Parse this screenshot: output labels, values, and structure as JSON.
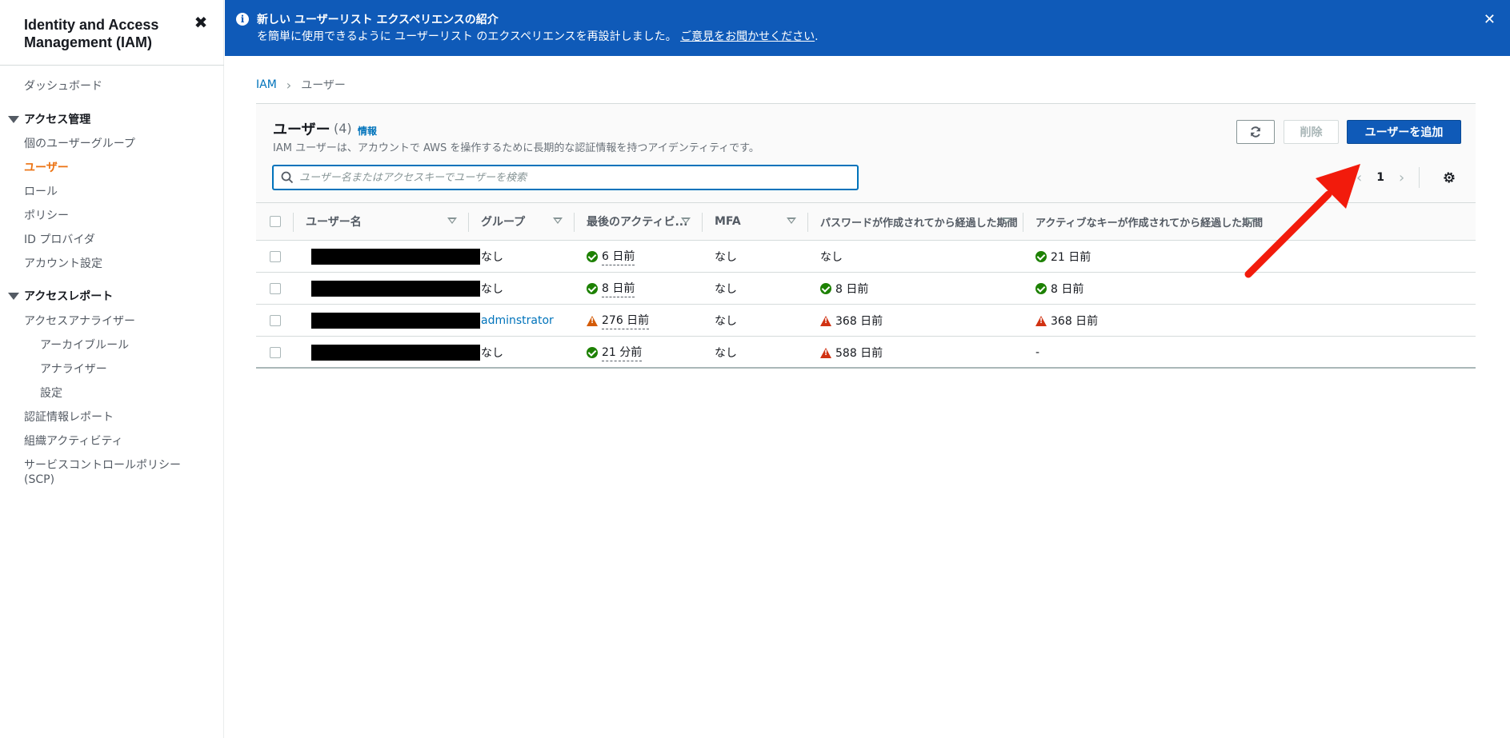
{
  "sidebar": {
    "title": "Identity and Access Management (IAM)",
    "close_glyph": "✖",
    "dashboard": "ダッシュボード",
    "access_management": {
      "label": "アクセス管理",
      "items": [
        "個のユーザーグループ",
        "ユーザー",
        "ロール",
        "ポリシー",
        "ID プロバイダ",
        "アカウント設定"
      ]
    },
    "access_reports": {
      "label": "アクセスレポート",
      "analyzer": "アクセスアナライザー",
      "analyzer_items": [
        "アーカイブルール",
        "アナライザー",
        "設定"
      ],
      "items": [
        "認証情報レポート",
        "組織アクティビティ",
        "サービスコントロールポリシー",
        "(SCP)"
      ]
    },
    "active_item": "ユーザー"
  },
  "banner": {
    "info_glyph": "i",
    "title": "新しい ユーザーリスト エクスペリエンスの紹介",
    "text": "を簡単に使用できるように ユーザーリスト のエクスペリエンスを再設計しました。",
    "link": "ご意見をお聞かせください",
    "link_suffix": ".",
    "close_glyph": "✕",
    "color": "#0f5ab8"
  },
  "breadcrumb": {
    "root": "IAM",
    "separator": "›",
    "current": "ユーザー"
  },
  "panel": {
    "title": "ユーザー",
    "count": "(4)",
    "info_link": "情報",
    "description": "IAM ユーザーは、アカウントで AWS を操作するために長期的な認証情報を持つアイデンティティです。",
    "delete_label": "削除",
    "add_user_label": "ユーザーを追加",
    "search_placeholder": "ユーザー名またはアクセスキーでユーザーを検索",
    "pager": {
      "prev": "‹",
      "page": "1",
      "next": "›"
    }
  },
  "table": {
    "columns": [
      "ユーザー名",
      "グループ",
      "最後のアクティビ...",
      "MFA",
      "パスワードが作成されてから経過した期間",
      "アクティブなキーが作成されてから経過した期間"
    ],
    "rows": [
      {
        "group": "なし",
        "group_link": false,
        "activity": "6 日前",
        "activity_status": "ok",
        "mfa": "なし",
        "password_age": "なし",
        "password_status": "none",
        "key_age": "21 日前",
        "key_status": "ok"
      },
      {
        "group": "なし",
        "group_link": false,
        "activity": "8 日前",
        "activity_status": "ok",
        "mfa": "なし",
        "password_age": "8 日前",
        "password_status": "ok",
        "key_age": "8 日前",
        "key_status": "ok"
      },
      {
        "group": "adminstrator",
        "group_link": true,
        "activity": "276 日前",
        "activity_status": "warn",
        "mfa": "なし",
        "password_age": "368 日前",
        "password_status": "err",
        "key_age": "368 日前",
        "key_status": "err"
      },
      {
        "group": "なし",
        "group_link": false,
        "activity": "21 分前",
        "activity_status": "ok",
        "mfa": "なし",
        "password_age": "588 日前",
        "password_status": "err",
        "key_age": "-",
        "key_status": "none"
      }
    ]
  },
  "colors": {
    "accent": "#ec7211",
    "primary": "#0f5ab8",
    "link": "#0073bb",
    "ok": "#1d8102",
    "warn": "#d45b07",
    "error": "#d13212",
    "annotation_arrow": "#f21b0c"
  },
  "icons": {
    "banner_info": "info-icon",
    "refresh": "refresh-icon",
    "search": "search-icon",
    "settings": "gear-icon"
  }
}
